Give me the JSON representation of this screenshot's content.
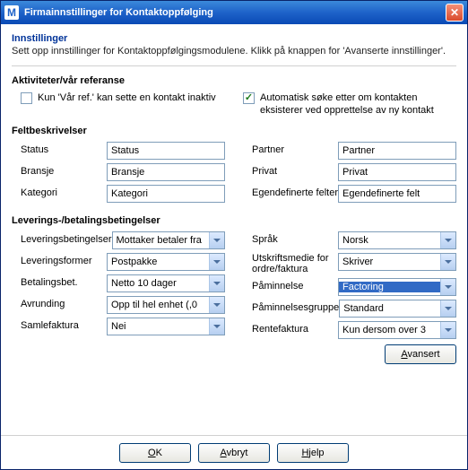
{
  "window": {
    "title": "Firmainnstillinger for Kontaktoppfølging"
  },
  "header": {
    "title": "Innstillinger",
    "desc": "Sett opp innstillinger for Kontaktoppfølgingsmodulene. Klikk på knappen for 'Avanserte innstillinger'."
  },
  "groups": {
    "activities": "Aktiviteter/vår referanse",
    "fields": "Feltbeskrivelser",
    "delivery": "Leverings-/betalingsbetingelser"
  },
  "checkboxes": {
    "inactive": {
      "label": "Kun 'Vår ref.' kan sette en kontakt inaktiv",
      "checked": false
    },
    "autosearch": {
      "label": "Automatisk søke etter om kontakten eksisterer ved opprettelse av ny kontakt",
      "checked": true
    }
  },
  "fields": {
    "status": {
      "label": "Status",
      "value": "Status"
    },
    "bransje": {
      "label": "Bransje",
      "value": "Bransje"
    },
    "kategori": {
      "label": "Kategori",
      "value": "Kategori"
    },
    "partner": {
      "label": "Partner",
      "value": "Partner"
    },
    "privat": {
      "label": "Privat",
      "value": "Privat"
    },
    "egendef": {
      "label": "Egendefinerte felter",
      "value": "Egendefinerte felt"
    }
  },
  "delivery": {
    "levbet": {
      "label": "Leveringsbetingelser",
      "value": "Mottaker betaler fra"
    },
    "levform": {
      "label": "Leveringsformer",
      "value": "Postpakke"
    },
    "betbet": {
      "label": "Betalingsbet.",
      "value": "Netto 10 dager"
    },
    "avrund": {
      "label": "Avrunding",
      "value": "Opp til hel enhet (,0"
    },
    "samle": {
      "label": "Samlefaktura",
      "value": "Nei"
    },
    "sprak": {
      "label": "Språk",
      "value": "Norsk"
    },
    "utskr": {
      "label": "Utskriftsmedie for ordre/faktura",
      "value": "Skriver"
    },
    "paaminn": {
      "label": "Påminnelse",
      "value": "Factoring",
      "highlighted": true
    },
    "paaminngr": {
      "label": "Påminnelsesgruppe",
      "value": "Standard"
    },
    "rentef": {
      "label": "Rentefaktura",
      "value": "Kun dersom over 3"
    }
  },
  "buttons": {
    "advanced": "Avansert",
    "ok": "OK",
    "cancel": "Avbryt",
    "help": "Hjelp"
  }
}
